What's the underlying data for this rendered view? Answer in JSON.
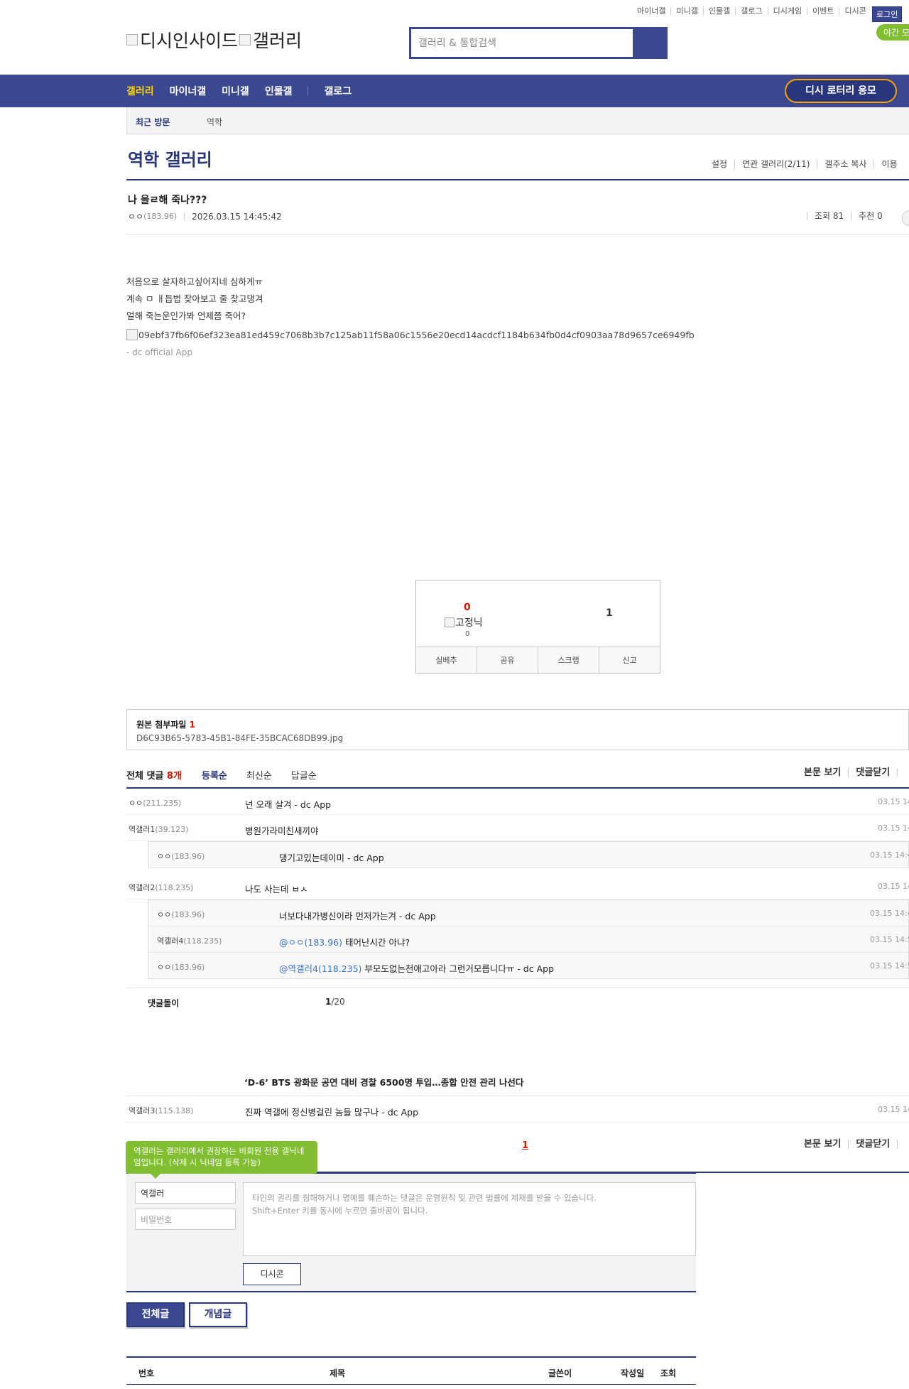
{
  "top_links": [
    "마이너갤",
    "미니갤",
    "인물갤",
    "갤로그",
    "디시게임",
    "이벤트",
    "디시콘"
  ],
  "login_label": "로그인",
  "night_label": "야간 모",
  "logo": {
    "alt1": "디시인사이드",
    "alt2": "갤러리"
  },
  "search": {
    "placeholder": "갤러리 & 통합검색"
  },
  "nav": {
    "items": [
      "갤러리",
      "마이너갤",
      "미니갤",
      "인물갤"
    ],
    "gallog": "갤로그",
    "lotto": "디시 로터리 응모"
  },
  "recent": {
    "label": "최근 방문",
    "value": "역학"
  },
  "gallery": {
    "title": "역학 갤러리",
    "tools": [
      "설정",
      "연관 갤러리(2/11)",
      "갤주소 복사",
      "이용"
    ]
  },
  "post": {
    "title": "나 올ㄹ해 죽나???",
    "author": "ㅇㅇ",
    "author_ip": "(183.96)",
    "date": "2026.03.15 14:45:42",
    "views": "조회 81",
    "recommend": "추천 0",
    "lines": [
      "처음으로 살자하고싶어지네 심하게ㅠ",
      "계속 ㅁ ㅐ듭법 찾아보고 줄 찾고댕겨",
      "얼해 죽는운인가봐 언제쯤 죽어?"
    ],
    "image_alt": "09ebf37fb6f06ef323ea81ed459c7068b3b7c125ab11f58a06c1556e20ecd14acdcf1184b634fb0d4cf0903aa78d9657ce6949fb",
    "signature": "- dc official App"
  },
  "vote": {
    "up": "0",
    "fix_alt": "고정닉",
    "fix_count": "0",
    "down": "1",
    "buttons": [
      "실베추",
      "공유",
      "스크랩",
      "신고"
    ]
  },
  "attachment": {
    "label": "원본 첨부파일",
    "count": "1",
    "file": "D6C93B65-5783-45B1-84FE-35BCAC68DB99.jpg"
  },
  "comments_header": {
    "label": "전체 댓글",
    "count": "8개",
    "sorts": [
      "등록순",
      "최신순",
      "답글순"
    ],
    "right": [
      "본문 보기",
      "댓글닫기"
    ]
  },
  "comments": [
    {
      "nick": "ㅇㅇ",
      "ip": "(211.235)",
      "text": "넌 오래 살겨 - dc App",
      "date": "03.15 14"
    },
    {
      "nick": "역갤러1",
      "ip": "(39.123)",
      "text": "병원가라미친새끼야",
      "date": "03.15 14"
    },
    {
      "nick": "역갤러2",
      "ip": "(118.235)",
      "text": "나도 사는데 ㅂㅅ",
      "date": "03.15 14"
    }
  ],
  "replies1": [
    {
      "nick": "ㅇㅇ",
      "ip": "(183.96)",
      "mention": "",
      "text": "댕기고있는데이미 - dc App",
      "date": "03.15 14:4"
    }
  ],
  "replies2": [
    {
      "nick": "ㅇㅇ",
      "ip": "(183.96)",
      "mention": "",
      "text": "너보다내가병신이라 먼저가는겨 - dc App",
      "date": "03.15 14:4"
    },
    {
      "nick": "역갤러4",
      "ip": "(118.235)",
      "mention": "@ㅇㅇ(183.96)",
      "text": " 태어난시간 아냐?",
      "date": "03.15 14:5"
    },
    {
      "nick": "ㅇㅇ",
      "ip": "(183.96)",
      "mention": "@역갤러4(118.235)",
      "text": " 부모도없는천애고아라 그런거모릅니다ㅠ - dc App",
      "date": "03.15 14:5"
    }
  ],
  "dolgi": {
    "label": "댓글돌이",
    "page": "1",
    "total": "/20"
  },
  "ad_title": "‘D-6’ BTS 광화문 공연 대비 경찰 6500명 투입…종합 안전 관리 나선다",
  "last_comment": {
    "nick": "역갤러3",
    "ip": "(115.138)",
    "text": "진짜 역갤에 정신병걸린 놈들 많구나 - dc App",
    "date": "03.15 14"
  },
  "comment_page": "1",
  "tip": "역갤러는 갤러리에서 권장하는 비회원 전용 갤닉네임입니다. (삭제 시 닉네임 등록 가능)",
  "write": {
    "nick": "역갤러",
    "pw_placeholder": "비밀번호",
    "notice1": "타인의 권리를 침해하거나 명예를 훼손하는 댓글은 운영원칙 및 관련 법률에 제재를 받을 수 있습니다.",
    "notice2": "Shift+Enter 키를 동시에 누르면 줄바꿈이 됩니다.",
    "dccon": "디시콘"
  },
  "tabs": {
    "all": "전체글",
    "concept": "개념글"
  },
  "list_headers": [
    "번호",
    "제목",
    "글쓴이",
    "작성일",
    "조회"
  ]
}
